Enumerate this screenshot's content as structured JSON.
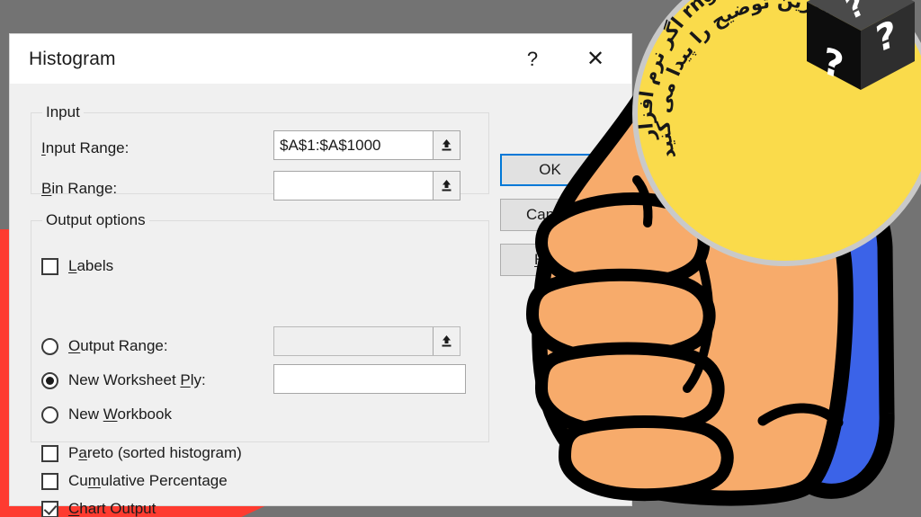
{
  "window": {
    "title": "Histogram",
    "help_icon": "question-mark-icon",
    "help_glyph": "?",
    "close_icon": "close-icon",
    "close_glyph": "✕"
  },
  "input_group": {
    "title": "Input",
    "fields": [
      {
        "label_prefix": "I",
        "label_rest": "nput Range:",
        "value": "$A$1:$A$1000",
        "placeholder": "",
        "disabled": false,
        "picker_icon": "collapse-dialog-icon"
      },
      {
        "label_prefix": "B",
        "label_rest": "in Range:",
        "value": "",
        "placeholder": "",
        "disabled": false,
        "picker_icon": "collapse-dialog-icon"
      }
    ],
    "labels_checkbox": {
      "prefix": "L",
      "rest": "abels",
      "checked": false
    }
  },
  "output_group": {
    "title": "Output options",
    "radios": [
      {
        "prefix": "O",
        "mid": "utput Range:",
        "selected": false,
        "underline_index": 1
      },
      {
        "prefix": "New Worksheet ",
        "mid": "Ply:",
        "selected": true,
        "underline_index": 2
      },
      {
        "prefix": "New Workbook",
        "mid": "",
        "selected": false,
        "underline_index": 3
      }
    ],
    "radio_labels": [
      {
        "pre": "",
        "u": "O",
        "post": "utput Range:"
      },
      {
        "pre": "New Worksheet ",
        "u": "P",
        "post": "ly:"
      },
      {
        "pre": "New ",
        "u": "W",
        "post": "orkbook"
      }
    ],
    "output_range_value": "",
    "output_range_placeholder": "",
    "output_range_disabled": true,
    "new_worksheet_value": "",
    "new_worksheet_placeholder": "",
    "checkboxes": [
      {
        "pre": "P",
        "u": "a",
        "post": "reto (sorted histogram)",
        "checked": false
      },
      {
        "pre": "Cu",
        "u": "m",
        "post": "ulative Percentage",
        "checked": false
      },
      {
        "pre": "",
        "u": "C",
        "post": "hart Output",
        "checked": true
      }
    ]
  },
  "buttons": [
    {
      "name": "ok-button",
      "pre": "",
      "u": "",
      "post": "OK",
      "default": true
    },
    {
      "name": "cancel-button",
      "pre": "",
      "u": "",
      "post": "Cancel",
      "default": false
    },
    {
      "name": "help-button",
      "pre": "",
      "u": "H",
      "post": "elp",
      "default": false
    }
  ],
  "badge": {
    "line_outer": "اگر نرم افزار rng را نمی شناسید،",
    "line_inner": "اینجا بهترین توضیح را پیدا می کنید!",
    "cube_icon": "mystery-question-cube-icon",
    "cube_glyph": "?"
  },
  "decoration": {
    "hand_icon": "thumbs-up-hand-icon",
    "skin_color": "#f7ab6b",
    "sleeve_color": "#3b63e8",
    "outline_color": "#000000"
  },
  "colors": {
    "background": "#737373",
    "accent_red": "#fe3b30",
    "badge_yellow": "#fadb4b",
    "focus_blue": "#0078d7",
    "dialog_face": "#f0f0f0"
  }
}
